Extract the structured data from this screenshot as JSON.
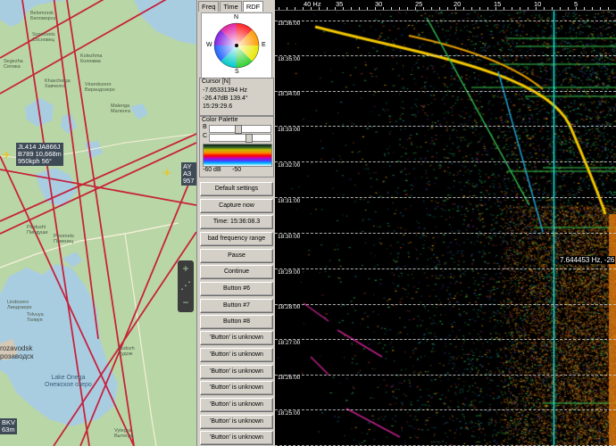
{
  "map": {
    "places": [
      {
        "name": "Belomorsk",
        "local": "Беломорск"
      },
      {
        "name": "Sosnovets",
        "local": "Сосновец"
      },
      {
        "name": "Segezha",
        "local": "Сегежа"
      },
      {
        "name": "Kolezhma",
        "local": "Колежма"
      },
      {
        "name": "Khavchelga",
        "local": "Хавчелга"
      },
      {
        "name": "Virandozero",
        "local": "Вирандозеро"
      },
      {
        "name": "Malenga",
        "local": "Маленга"
      },
      {
        "name": "Pindushi",
        "local": "Пиндуши"
      },
      {
        "name": "Povenets",
        "local": "Повенец"
      },
      {
        "name": "Lindozero",
        "local": "Линдозеро"
      },
      {
        "name": "Tolvuya",
        "local": "Толвуя"
      },
      {
        "name": "Pudozh",
        "local": "Пудож"
      },
      {
        "name": "Vytegra",
        "local": "Вытегра"
      }
    ],
    "city": {
      "name": "rozavodsk",
      "local": "розаводск"
    },
    "lake": {
      "name": "Lake Onega",
      "local": "Онежское озеро"
    },
    "flights": [
      {
        "callsign": "JL414 JA866J",
        "detail": "B789 10,668m",
        "speed": "950kph 56°"
      },
      {
        "callsign": "AY",
        "detail": "A3",
        "speed": "957"
      },
      {
        "callsign": "BKV",
        "detail": "63m",
        "speed": ""
      }
    ],
    "zoom": {
      "in": "+",
      "out": "−",
      "drag": "⋰"
    }
  },
  "panel": {
    "tabs": [
      "Freq",
      "Time",
      "RDF"
    ],
    "active_tab": "RDF",
    "compass": {
      "n": "N",
      "e": "E",
      "s": "S",
      "w": "W"
    },
    "cursor": {
      "title": "Cursor [N]",
      "freq": "-7.65331394 Hz",
      "level": "-26.47dB 139.4°",
      "time": "15:29:29.6"
    },
    "palette": {
      "title": "Color Palette",
      "b_label": "B",
      "c_label": "C",
      "db_low": "-60 dB",
      "db_high": "-50"
    },
    "buttons": [
      "Default settings",
      "Capture now",
      "Time:  15:36:08.3",
      "bad frequency range",
      "Pause",
      "Continue",
      "Button #6",
      "Button #7",
      "Button #8",
      "'Button' is unknown",
      "'Button' is unknown",
      "'Button' is unknown",
      "'Button' is unknown",
      "'Button' is unknown",
      "'Button' is unknown",
      "'Button' is unknown"
    ]
  },
  "waterfall": {
    "freq_ticks": [
      "40 Hz",
      "35",
      "30",
      "25",
      "20",
      "15",
      "10",
      "5"
    ],
    "time_labels": [
      "18:36:00",
      "18:35:00",
      "18:34:00",
      "18:33:00",
      "18:32:00",
      "18:31:00",
      "18:30:00",
      "18:29:00",
      "18:28:00",
      "18:27:00",
      "18:26:00",
      "18:25:00"
    ],
    "cursor_readout": "7.644453 Hz, -26",
    "colors": {
      "cursor": "#1fe0d5",
      "trace": "#f5c800"
    }
  }
}
